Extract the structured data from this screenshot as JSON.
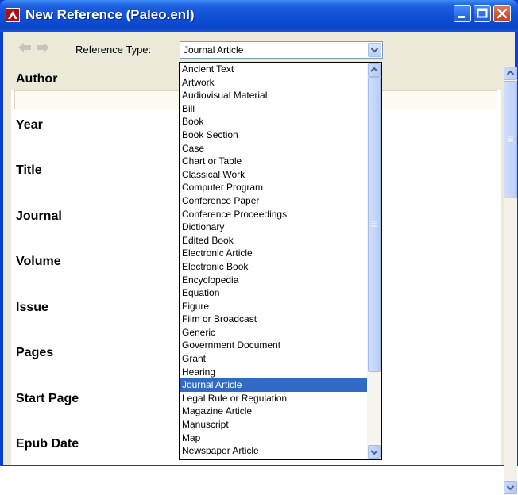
{
  "window": {
    "title": "New Reference (Paleo.enl)"
  },
  "toolbar": {
    "reference_type_label": "Reference Type:",
    "reference_type_value": "Journal Article"
  },
  "fields": [
    "Author",
    "Year",
    "Title",
    "Journal",
    "Volume",
    "Issue",
    "Pages",
    "Start Page",
    "Epub Date"
  ],
  "dropdown": {
    "items": [
      "Ancient Text",
      "Artwork",
      "Audiovisual Material",
      "Bill",
      "Book",
      "Book Section",
      "Case",
      "Chart or Table",
      "Classical Work",
      "Computer Program",
      "Conference Paper",
      "Conference Proceedings",
      "Dictionary",
      "Edited Book",
      "Electronic Article",
      "Electronic Book",
      "Encyclopedia",
      "Equation",
      "Figure",
      "Film or Broadcast",
      "Generic",
      "Government Document",
      "Grant",
      "Hearing",
      "Journal Article",
      "Legal Rule or Regulation",
      "Magazine Article",
      "Manuscript",
      "Map",
      "Newspaper Article"
    ],
    "selected": "Journal Article"
  },
  "colors": {
    "titlebar": "#0f4fd6",
    "selection": "#316ac5",
    "chrome": "#ece9d8"
  }
}
